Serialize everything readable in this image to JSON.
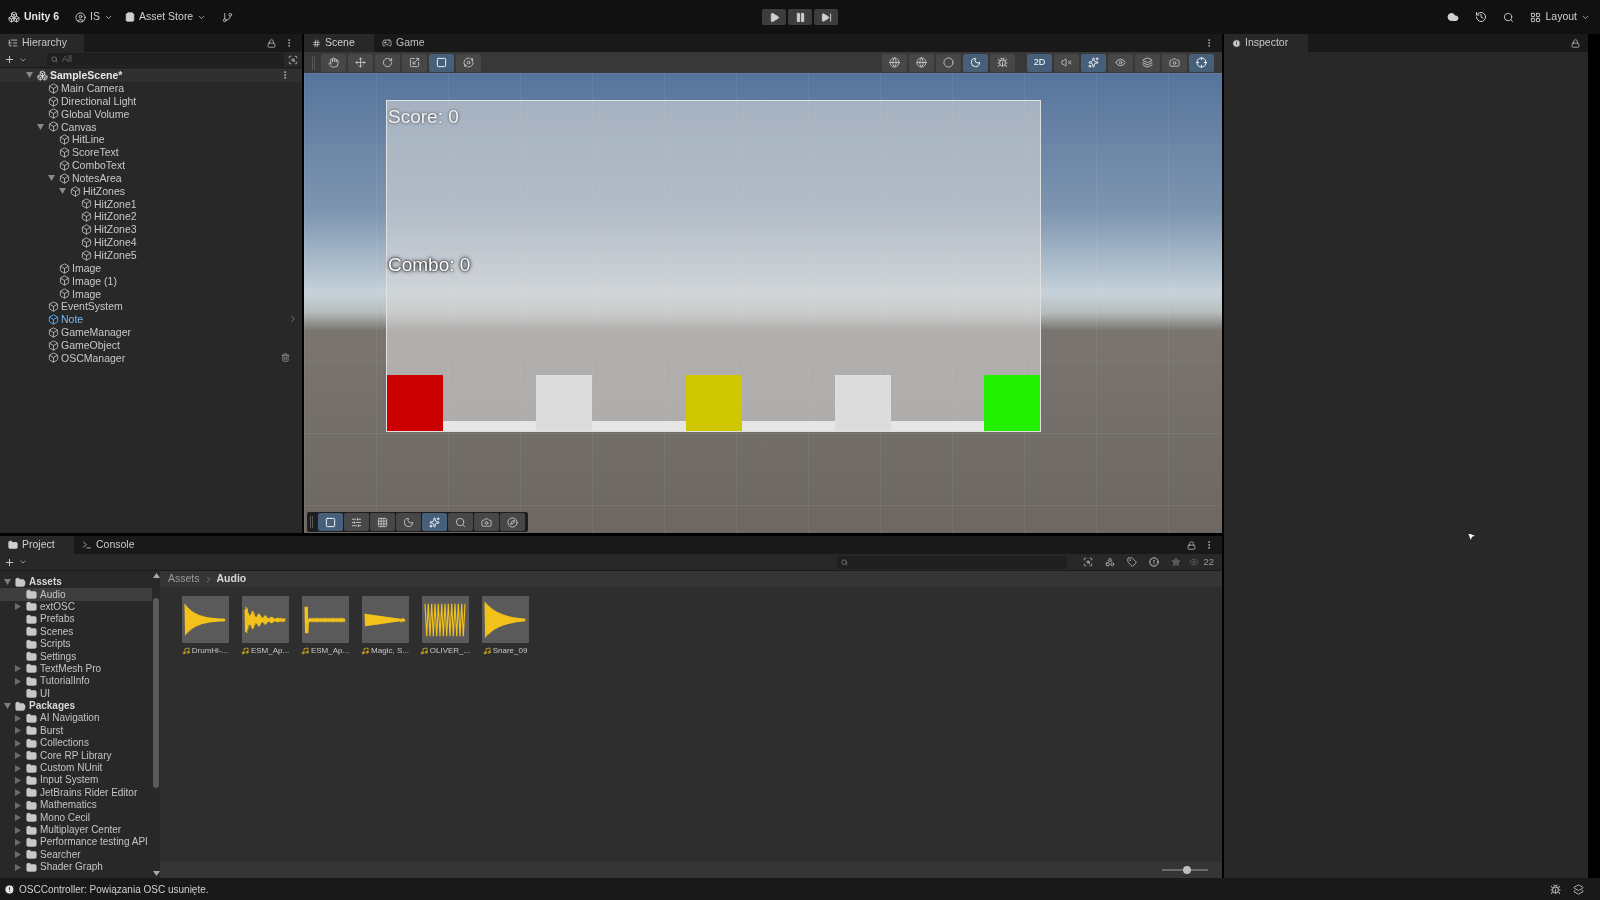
{
  "topbar": {
    "product": "Unity 6",
    "account": "IS",
    "store": "Asset Store",
    "layout": "Layout"
  },
  "play_controls": [
    {
      "kind": "play"
    },
    {
      "kind": "pause"
    },
    {
      "kind": "step"
    }
  ],
  "hierarchy": {
    "title": "Hierarchy",
    "placeholder": "All",
    "items": [
      {
        "label": "SampleScene*",
        "kind": "scene",
        "expanded": true,
        "children": [
          {
            "label": "Main Camera",
            "kind": "object"
          },
          {
            "label": "Directional Light",
            "kind": "object"
          },
          {
            "label": "Global Volume",
            "kind": "object"
          },
          {
            "label": "Canvas",
            "kind": "object",
            "expanded": true,
            "children": [
              {
                "label": "HitLine",
                "kind": "object"
              },
              {
                "label": "ScoreText",
                "kind": "object"
              },
              {
                "label": "ComboText",
                "kind": "object"
              },
              {
                "label": "NotesArea",
                "kind": "object",
                "expanded": true,
                "children": [
                  {
                    "label": "HitZones",
                    "kind": "object",
                    "expanded": true,
                    "children": [
                      {
                        "label": "HitZone1",
                        "kind": "object"
                      },
                      {
                        "label": "HitZone2",
                        "kind": "object"
                      },
                      {
                        "label": "HitZone3",
                        "kind": "object"
                      },
                      {
                        "label": "HitZone4",
                        "kind": "object"
                      },
                      {
                        "label": "HitZone5",
                        "kind": "object"
                      }
                    ]
                  }
                ]
              },
              {
                "label": "Image",
                "kind": "object"
              },
              {
                "label": "Image (1)",
                "kind": "object"
              },
              {
                "label": "Image",
                "kind": "object"
              }
            ]
          },
          {
            "label": "EventSystem",
            "kind": "object"
          },
          {
            "label": "Note",
            "kind": "prefab"
          },
          {
            "label": "GameManager",
            "kind": "object"
          },
          {
            "label": "GameObject",
            "kind": "object"
          },
          {
            "label": "OSCManager",
            "kind": "object",
            "hovered": true
          }
        ]
      }
    ]
  },
  "scene_view": {
    "tabs": [
      {
        "label": "Scene",
        "kind": "scene",
        "selected": true
      },
      {
        "label": "Game",
        "kind": "game",
        "selected": false
      }
    ],
    "tools": [
      {
        "kind": "hand",
        "selected": false
      },
      {
        "kind": "move",
        "selected": false
      },
      {
        "kind": "rotate",
        "selected": false
      },
      {
        "kind": "scale",
        "selected": false
      },
      {
        "kind": "rect",
        "selected": true
      },
      {
        "kind": "transform",
        "selected": false
      }
    ],
    "view_options": [
      {
        "kind": "globe",
        "selected": false
      },
      {
        "kind": "shading",
        "selected": false
      },
      {
        "kind": "sphere",
        "selected": false
      },
      {
        "kind": "moon",
        "selected": true
      },
      {
        "kind": "bug",
        "selected": false
      }
    ],
    "mode_2d": {
      "label": "2D",
      "selected": true
    },
    "view_options_2": [
      {
        "kind": "audio-off",
        "selected": false
      },
      {
        "kind": "effects",
        "selected": true
      },
      {
        "kind": "eye",
        "selected": false
      },
      {
        "kind": "layers",
        "selected": false
      },
      {
        "kind": "camera",
        "selected": false
      },
      {
        "kind": "gizmos",
        "selected": true
      }
    ],
    "overlay_tools": [
      {
        "kind": "rect",
        "selected": true
      },
      {
        "kind": "sliders",
        "selected": false
      },
      {
        "kind": "grid",
        "selected": false
      },
      {
        "kind": "moon",
        "selected": false
      },
      {
        "kind": "effects",
        "selected": true
      },
      {
        "kind": "search",
        "selected": false
      },
      {
        "kind": "camera",
        "selected": false
      },
      {
        "kind": "compass",
        "selected": false
      }
    ],
    "canvas": {
      "score": "Score: 0",
      "combo": "Combo: 0",
      "hit_zones": [
        {
          "color": "#cc0000"
        },
        {
          "color": "#dcdcdc"
        },
        {
          "color": "#cfc800"
        },
        {
          "color": "#dcdcdc"
        },
        {
          "color": "#22ee00"
        }
      ]
    }
  },
  "inspector": {
    "title": "Inspector"
  },
  "project": {
    "tabs": [
      {
        "label": "Project",
        "kind": "folder",
        "selected": true
      },
      {
        "label": "Console",
        "kind": "console",
        "selected": false
      }
    ],
    "count": "22",
    "tree": [
      {
        "label": "Assets",
        "expanded": true,
        "selected": false,
        "children": [
          {
            "label": "Audio",
            "selected": true
          },
          {
            "label": "extOSC",
            "expandable": true,
            "selected": false
          },
          {
            "label": "Prefabs",
            "selected": false
          },
          {
            "label": "Scenes",
            "selected": false
          },
          {
            "label": "Scripts",
            "selected": false
          },
          {
            "label": "Settings",
            "selected": false
          },
          {
            "label": "TextMesh Pro",
            "expandable": true,
            "selected": false
          },
          {
            "label": "TutorialInfo",
            "expandable": true,
            "selected": false
          },
          {
            "label": "UI",
            "selected": false
          }
        ]
      },
      {
        "label": "Packages",
        "expanded": true,
        "selected": false,
        "children": [
          {
            "label": "AI Navigation",
            "expandable": true,
            "selected": false
          },
          {
            "label": "Burst",
            "expandable": true,
            "selected": false
          },
          {
            "label": "Collections",
            "expandable": true,
            "selected": false
          },
          {
            "label": "Core RP Library",
            "expandable": true,
            "selected": false
          },
          {
            "label": "Custom NUnit",
            "expandable": true,
            "selected": false
          },
          {
            "label": "Input System",
            "expandable": true,
            "selected": false
          },
          {
            "label": "JetBrains Rider Editor",
            "expandable": true,
            "selected": false
          },
          {
            "label": "Mathematics",
            "expandable": true,
            "selected": false
          },
          {
            "label": "Mono Cecil",
            "expandable": true,
            "selected": false
          },
          {
            "label": "Multiplayer Center",
            "expandable": true,
            "selected": false
          },
          {
            "label": "Performance testing API",
            "expandable": true,
            "selected": false
          },
          {
            "label": "Searcher",
            "expandable": true,
            "selected": false
          },
          {
            "label": "Shader Graph",
            "expandable": true,
            "selected": false
          }
        ]
      }
    ],
    "breadcrumb": [
      "Assets",
      "Audio"
    ],
    "assets": [
      {
        "name": "DrumHi-..."
      },
      {
        "name": "ESM_Ap..."
      },
      {
        "name": "ESM_Ap..."
      },
      {
        "name": "Magic, S..."
      },
      {
        "name": "OLIVER_..."
      },
      {
        "name": "Snare_09"
      }
    ],
    "zoom": {
      "level": 0.55
    }
  },
  "status_bar": {
    "message": "OSCController: Powiązania OSC usunięte."
  }
}
